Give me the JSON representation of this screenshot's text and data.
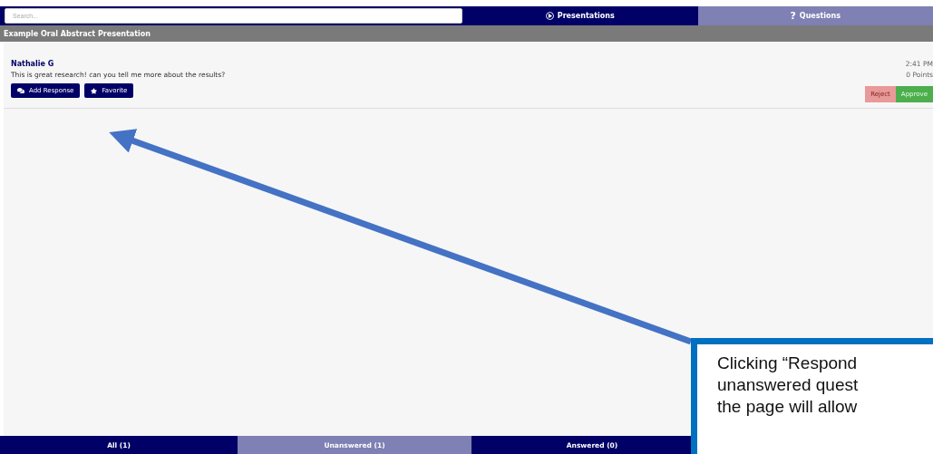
{
  "search": {
    "placeholder": "Search..."
  },
  "nav_tabs": [
    {
      "label": "Presentations",
      "selected": false
    },
    {
      "label": "Questions",
      "symbol": "?",
      "selected": true
    }
  ],
  "presentation_title": "Example Oral Abstract Presentation",
  "questions": [
    {
      "author": "Nathalie G",
      "text": "This is great research! can you tell me more about the results?",
      "time": "2:41 PM",
      "points": "0 Points",
      "actions": [
        {
          "label": "Add Response",
          "kind": "respond"
        },
        {
          "label": "Favorite",
          "kind": "favorite"
        }
      ],
      "moderation": [
        {
          "label": "Reject",
          "kind": "reject"
        },
        {
          "label": "Approve",
          "kind": "approve"
        }
      ]
    }
  ],
  "filter_tabs": [
    {
      "label": "All (1)",
      "selected": false
    },
    {
      "label": "Unanswered (1)",
      "selected": true
    },
    {
      "label": "Answered (0)",
      "selected": false
    }
  ],
  "callout": {
    "lines": [
      "Clicking “Respond",
      "unanswered quest",
      "the page will allow"
    ]
  }
}
